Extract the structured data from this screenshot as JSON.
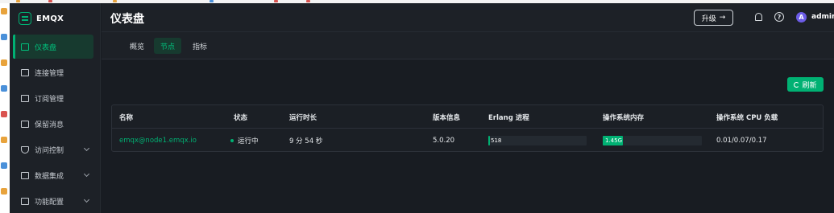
{
  "app": {
    "logo_text": "EMQX"
  },
  "header": {
    "title": "仪表盘",
    "upgrade_label": "升级",
    "user_initial": "A",
    "username": "admin"
  },
  "sidebar": {
    "items": [
      {
        "label": "仪表盘",
        "icon": "dashboard-icon",
        "active": true,
        "expandable": false
      },
      {
        "label": "连接管理",
        "icon": "connections-icon",
        "active": false,
        "expandable": false
      },
      {
        "label": "订阅管理",
        "icon": "subscriptions-icon",
        "active": false,
        "expandable": false
      },
      {
        "label": "保留消息",
        "icon": "retained-icon",
        "active": false,
        "expandable": false
      },
      {
        "label": "访问控制",
        "icon": "shield-icon",
        "active": false,
        "expandable": true
      },
      {
        "label": "数据集成",
        "icon": "integration-icon",
        "active": false,
        "expandable": true
      },
      {
        "label": "功能配置",
        "icon": "settings-icon",
        "active": false,
        "expandable": true
      }
    ]
  },
  "tabs": [
    {
      "label": "概览",
      "active": false
    },
    {
      "label": "节点",
      "active": true
    },
    {
      "label": "指标",
      "active": false
    }
  ],
  "refresh_label": "刷新",
  "table": {
    "headers": [
      "名称",
      "状态",
      "运行时长",
      "版本信息",
      "Erlang 进程",
      "操作系统内存",
      "操作系统 CPU 负载"
    ],
    "rows": [
      {
        "name": "emqx@node1.emqx.io",
        "status": "运行中",
        "uptime": "9 分 54 秒",
        "version": "5.0.20",
        "erlang_processes": "518",
        "erlang_process_fraction": 0.01,
        "memory": "1.45G",
        "memory_fraction": 0.2,
        "cpu_load": "0.01/0.07/0.17"
      }
    ]
  },
  "colors": {
    "accent": "#00b173",
    "background": "#181c22",
    "sidebar": "#1d2127",
    "avatar": "#6c5ce7"
  }
}
